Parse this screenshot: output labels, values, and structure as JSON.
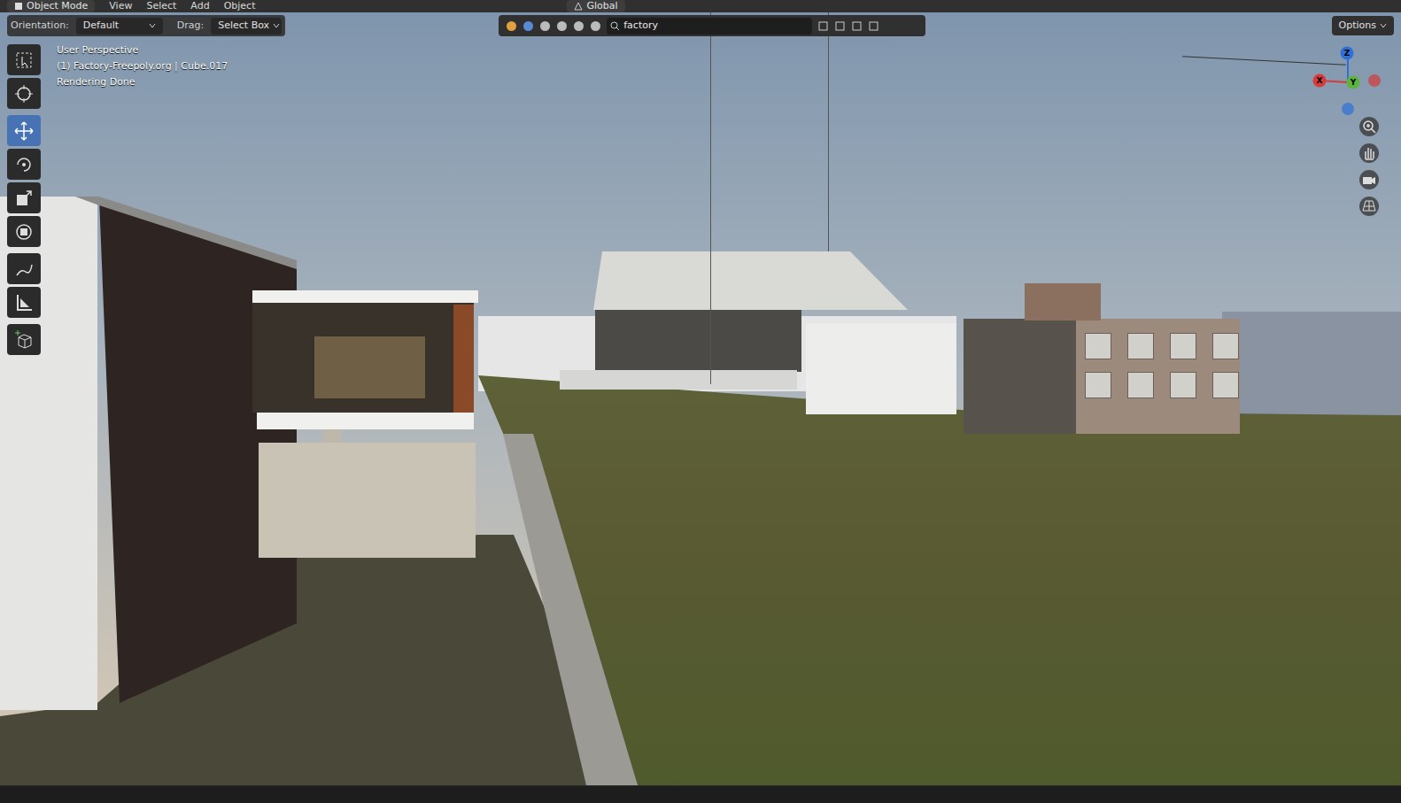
{
  "header": {
    "mode": "Object Mode",
    "menus": [
      "View",
      "Select",
      "Add",
      "Object"
    ],
    "transform_orientation": "Global"
  },
  "tool_settings": {
    "orientation_label": "Orientation:",
    "orientation": "Default",
    "drag_label": "Drag:",
    "drag": "Select Box",
    "options": "Options"
  },
  "filter": {
    "value": "factory"
  },
  "toolbar": [
    {
      "kind": "select",
      "selected": false
    },
    {
      "kind": "cursor",
      "selected": false
    },
    {
      "kind": "move",
      "selected": true
    },
    {
      "kind": "rotate",
      "selected": false
    },
    {
      "kind": "scale",
      "selected": false
    },
    {
      "kind": "transform",
      "selected": false
    },
    {
      "kind": "annotate",
      "selected": false
    },
    {
      "kind": "measure",
      "selected": false
    },
    {
      "kind": "addcube",
      "selected": false
    }
  ],
  "viewport": {
    "overlay_lines": [
      "User Perspective",
      "(1) Factory-Freepoly.org | Cube.017",
      "Rendering Done"
    ]
  },
  "gizmo": {
    "axes": [
      {
        "label": "Z",
        "color": "#2f6fd6"
      },
      {
        "label": "X",
        "color": "#d63a3a"
      },
      {
        "label": "Y",
        "color": "#5ab63a"
      }
    ]
  }
}
